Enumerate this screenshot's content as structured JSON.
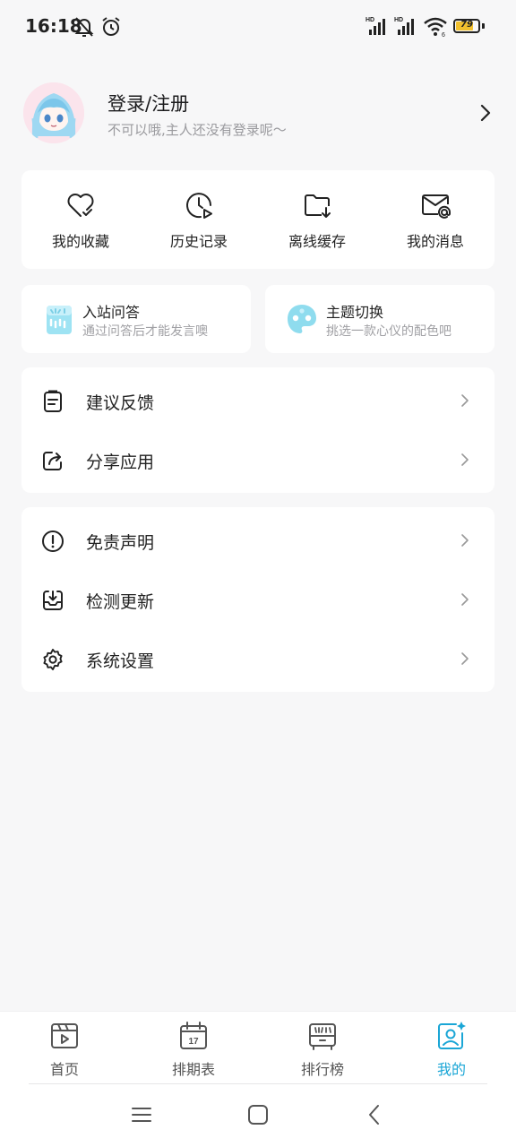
{
  "status_bar": {
    "time": "16:18",
    "battery": "79"
  },
  "profile": {
    "title": "登录/注册",
    "subtitle": "不可以哦,主人还没有登录呢～"
  },
  "quick_actions": [
    {
      "label": "我的收藏",
      "icon": "heart-check-icon"
    },
    {
      "label": "历史记录",
      "icon": "clock-play-icon"
    },
    {
      "label": "离线缓存",
      "icon": "folder-download-icon"
    },
    {
      "label": "我的消息",
      "icon": "mail-at-icon"
    }
  ],
  "features": [
    {
      "title": "入站问答",
      "subtitle": "通过问答后才能发言噢",
      "icon": "quiz-icon"
    },
    {
      "title": "主题切换",
      "subtitle": "挑选一款心仪的配色吧",
      "icon": "palette-icon"
    }
  ],
  "menu_group_1": [
    {
      "label": "建议反馈",
      "icon": "clipboard-icon"
    },
    {
      "label": "分享应用",
      "icon": "share-icon"
    }
  ],
  "menu_group_2": [
    {
      "label": "免责声明",
      "icon": "alert-circle-icon"
    },
    {
      "label": "检测更新",
      "icon": "download-tray-icon"
    },
    {
      "label": "系统设置",
      "icon": "gear-icon"
    }
  ],
  "bottom_nav": [
    {
      "label": "首页",
      "icon": "home-play-icon",
      "active": false
    },
    {
      "label": "排期表",
      "icon": "calendar-icon",
      "active": false,
      "calendar_day": "17"
    },
    {
      "label": "排行榜",
      "icon": "ranking-icon",
      "active": false
    },
    {
      "label": "我的",
      "icon": "profile-sparkle-icon",
      "active": true
    }
  ],
  "colors": {
    "accent": "#1aa6d6",
    "background": "#f7f7f8",
    "card": "#ffffff",
    "battery": "#f2c12e"
  }
}
